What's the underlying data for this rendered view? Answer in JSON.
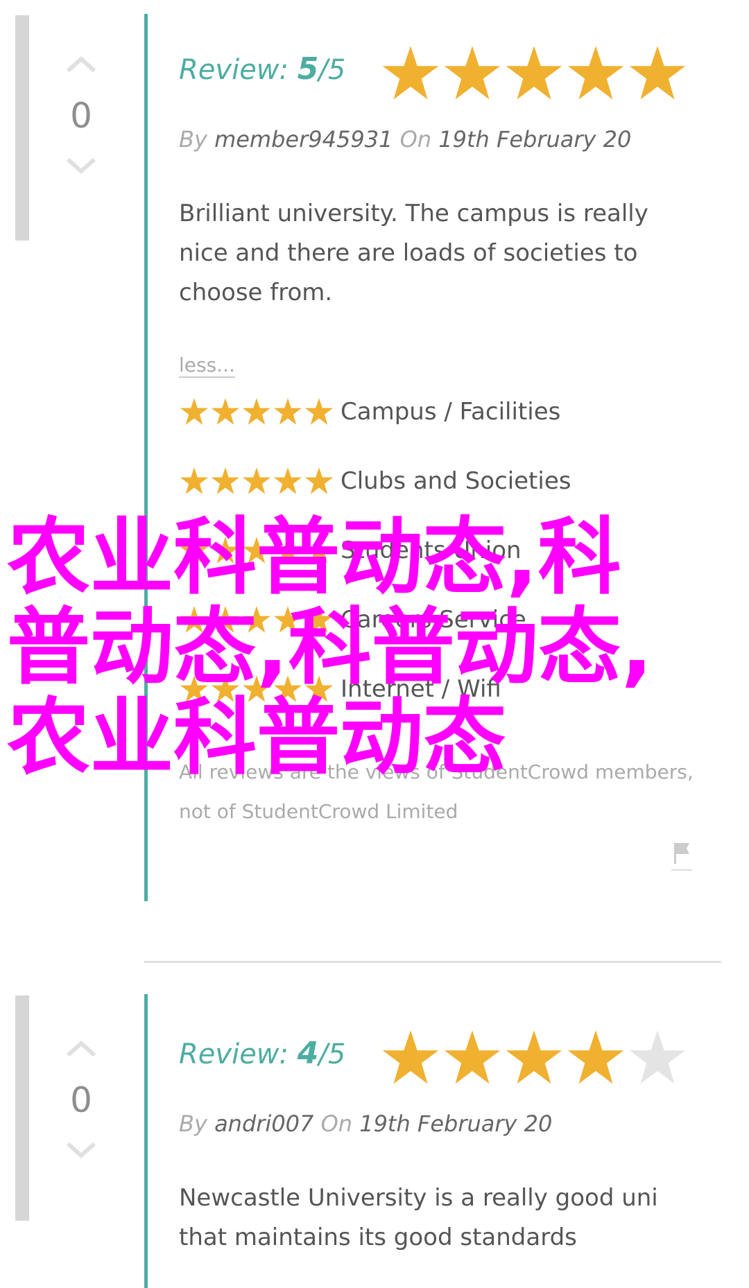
{
  "colors": {
    "accent": "#4dada2",
    "star_full": "#f0b030",
    "star_empty": "#e4e4e4",
    "overlay": "#ff00ff"
  },
  "reviews": [
    {
      "votes": "0",
      "review_label": "Review:",
      "score": "5",
      "out_of": "/5",
      "rating": 5,
      "by_label": "By",
      "author": "member945931",
      "on_label": "On",
      "date": "19th February 20",
      "body": "Brilliant university. The campus is really nice and there are loads of societies to choose from.",
      "less_label": "less...",
      "categories": [
        {
          "label": "Campus / Facilities",
          "rating": 5
        },
        {
          "label": "Clubs and Societies",
          "rating": 5
        },
        {
          "label": "Students Union",
          "rating": 5
        },
        {
          "label": "Careers Service",
          "rating": 5
        },
        {
          "label": "Internet / Wifi",
          "rating": 5
        }
      ],
      "disclaimer": "All reviews are the views of StudentCrowd members, not of StudentCrowd Limited"
    },
    {
      "votes": "0",
      "review_label": "Review:",
      "score": "4",
      "out_of": "/5",
      "rating": 4,
      "by_label": "By",
      "author": "andri007",
      "on_label": "On",
      "date": "19th February 20",
      "body": "Newcastle University is a really good uni that maintains its good standards"
    }
  ],
  "overlay_text": "农业科普动态,科普动态,科普动态,农业科普动态"
}
